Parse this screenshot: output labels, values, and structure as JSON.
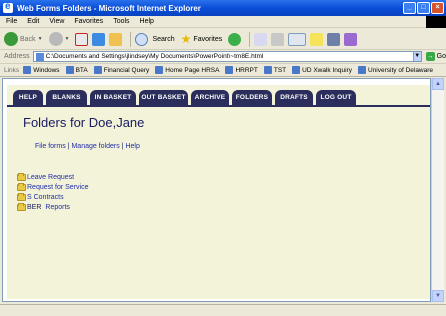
{
  "window": {
    "title": "Web Forms Folders - Microsoft Internet Explorer"
  },
  "menu": [
    "File",
    "Edit",
    "View",
    "Favorites",
    "Tools",
    "Help"
  ],
  "toolbar": {
    "back_label": "Back",
    "search_label": "Search",
    "favorites_label": "Favorites"
  },
  "address": {
    "label": "Address",
    "url": "C:\\Documents and Settings\\jlindsey\\My Documents\\PowerPoint\\~tm8E.html",
    "go_label": "Go"
  },
  "links": {
    "label": "Links",
    "items": [
      "Windows",
      "BTA",
      "Financial Query",
      "Home Page HRSA",
      "HRRPT",
      "TST",
      "UD Xwalk Inquiry",
      "University of Delaware"
    ]
  },
  "nav": [
    "HELP",
    "BLANKS",
    "IN BASKET",
    "OUT BASKET",
    "ARCHIVE",
    "FOLDERS",
    "DRAFTS",
    "LOG OUT"
  ],
  "page": {
    "heading": "Folders for Doe,Jane",
    "links": [
      "File forms",
      "Manage folders",
      "Help"
    ],
    "separator": "|"
  },
  "folders": [
    {
      "prefix": "",
      "label": "Leave Request"
    },
    {
      "prefix": "",
      "label": "Request for Service"
    },
    {
      "prefix": "",
      "label": "S Contracts"
    },
    {
      "prefix": "BER",
      "label": "Reports"
    }
  ]
}
